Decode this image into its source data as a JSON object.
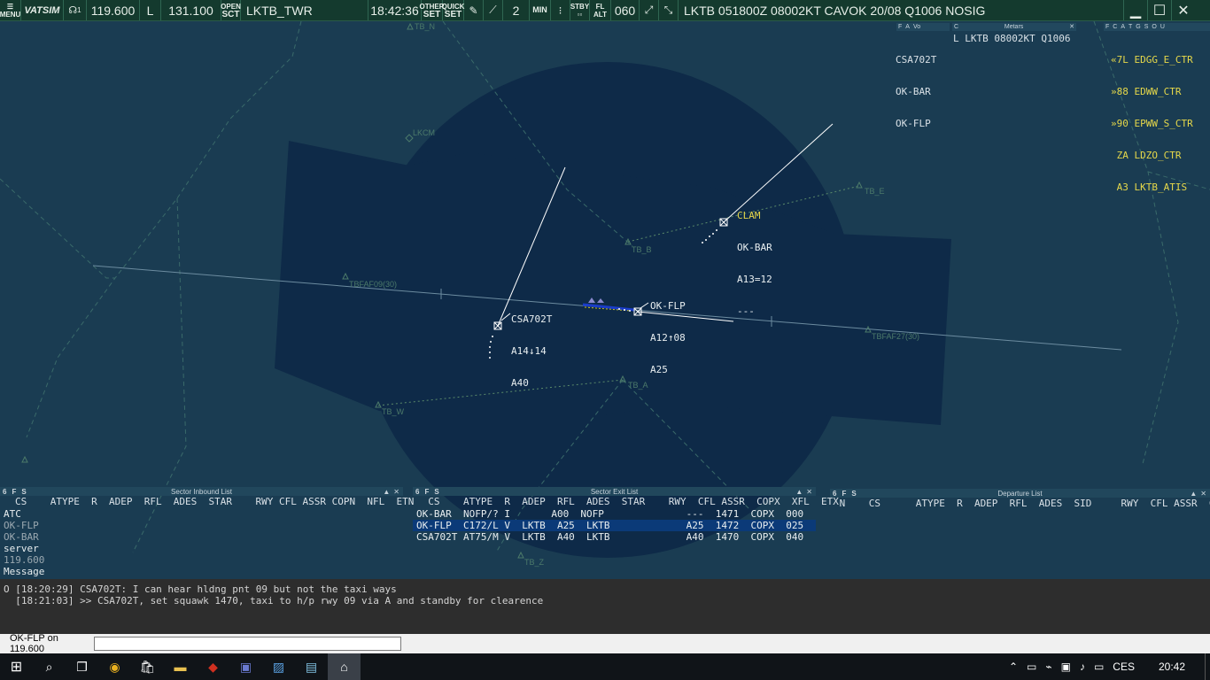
{
  "toolbar": {
    "menu": "MENU",
    "vatsim": "VATSIM",
    "headset_index": "1",
    "freq_primary": "119.600",
    "mode": "L",
    "freq_secondary": "131.100",
    "open_top": "OPEN",
    "open_bottom": "SCT",
    "callsign": "LKTB_TWR",
    "time": "18:42:36",
    "other_top": "OTHER",
    "other_bottom": "SET",
    "quick_top": "QUICK",
    "quick_bottom": "SET",
    "min_value": "2",
    "min_label": "MIN",
    "stby": "STBY",
    "fl_top": "FL",
    "fl_bottom": "ALT",
    "transition": "060",
    "metar": "LKTB 051800Z 08002KT CAVOK 20/08 Q1006 NOSIG"
  },
  "fixes": {
    "tb_n": "TB_N",
    "lkcm": "LKCM",
    "tb_e": "TB_E",
    "tb_b": "TB_B",
    "tbfaf09": "TBFAF09(30)",
    "tbfaf27": "TBFAF27(30)",
    "tb_a": "TB_A",
    "tb_w": "TB_W",
    "tb_z": "TB_Z"
  },
  "targets": {
    "okbar": {
      "status": "CLAM",
      "callsign": "OK-BAR",
      "alt_line": "A13=12",
      "third": "---"
    },
    "okflp": {
      "callsign": "OK-FLP",
      "alt_line": "A12↑08",
      "third": "A25"
    },
    "csa": {
      "callsign": "CSA702T",
      "alt_line": "A14↓14",
      "third": "A40"
    }
  },
  "top_lists": {
    "flight_hdr": [
      "F",
      "A",
      "Vo"
    ],
    "metars_title": "Metars",
    "metars_c": "C",
    "controller_hdr": [
      "F",
      "C",
      "A",
      "T",
      "G",
      "S",
      "O",
      "U"
    ],
    "aircraft": [
      "CSA702T",
      "OK-BAR",
      "OK-FLP"
    ],
    "metar_line": "L LKTB 08002KT Q1006",
    "controllers": [
      "«7L EDGG_E_CTR",
      "»88 EDWW_CTR",
      "»90 EPWW_S_CTR",
      " ZA LDZO_CTR",
      " A3 LKTB_ATIS"
    ]
  },
  "inbound": {
    "title": "Sector Inbound List",
    "ctrls": [
      "6",
      "F",
      "S"
    ],
    "cols": "CS    ATYPE  R  ADEP  RFL  ADES  STAR    RWY CFL ASSR COPN  NFL  ETN",
    "side": [
      "ATC",
      "OK-FLP",
      "OK-BAR",
      "server",
      "119.600",
      "Message"
    ]
  },
  "exit": {
    "title": "Sector Exit List",
    "ctrls": [
      "6",
      "F",
      "S"
    ],
    "cols": "  CS    ATYPE  R  ADEP  RFL  ADES  STAR    RWY  CFL ASSR  COPX  XFL  ETX",
    "rows": [
      {
        "text": "OK-BAR  NOFP/? I       A00  NOFP              ---  1471  COPX  000",
        "selected": false
      },
      {
        "text": "OK-FLP  C172/L V  LKTB  A25  LKTB             A25  1472  COPX  025",
        "selected": true
      },
      {
        "text": "CSA702T AT75/M V  LKTB  A40  LKTB             A40  1470  COPX  040",
        "selected": false
      }
    ]
  },
  "departure": {
    "title": "Departure List",
    "ctrls": [
      "6",
      "F",
      "S"
    ],
    "cols": " N    CS      ATYPE  R  ADEP  RFL  ADES  SID     RWY  CFL ASSR  C  STS"
  },
  "messages": [
    "O [18:20:29] CSA702T: I can hear hldng pnt 09 but not the taxi ways",
    "  [18:21:03] >> CSA702T, set squawk 1470, taxi to h/p rwy 09 via A and standby for clearence"
  ],
  "command": {
    "target": "OK-FLP on 119.600",
    "value": ""
  },
  "taskbar": {
    "language": "CES",
    "clock": "20:42"
  },
  "colors": {
    "background": "#1a3c52",
    "sector": "#0e2a48",
    "toolbar": "#143a2e",
    "tag_yellow": "#e6d84a",
    "selection": "#0b3a78"
  }
}
